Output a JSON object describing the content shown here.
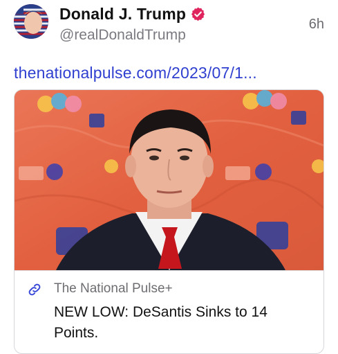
{
  "post": {
    "display_name": "Donald J. Trump",
    "handle": "@realDonaldTrump",
    "timestamp": "6h",
    "link_text": "thenationalpulse.com/2023/07/1...",
    "verified_icon": "verified-badge-icon",
    "accent_color": "#2f3fd0",
    "verified_color": "#e0245e"
  },
  "card": {
    "source": "The National Pulse+",
    "title": "NEW LOW: DeSantis Sinks to 14 Points.",
    "link_icon": "link-icon"
  }
}
